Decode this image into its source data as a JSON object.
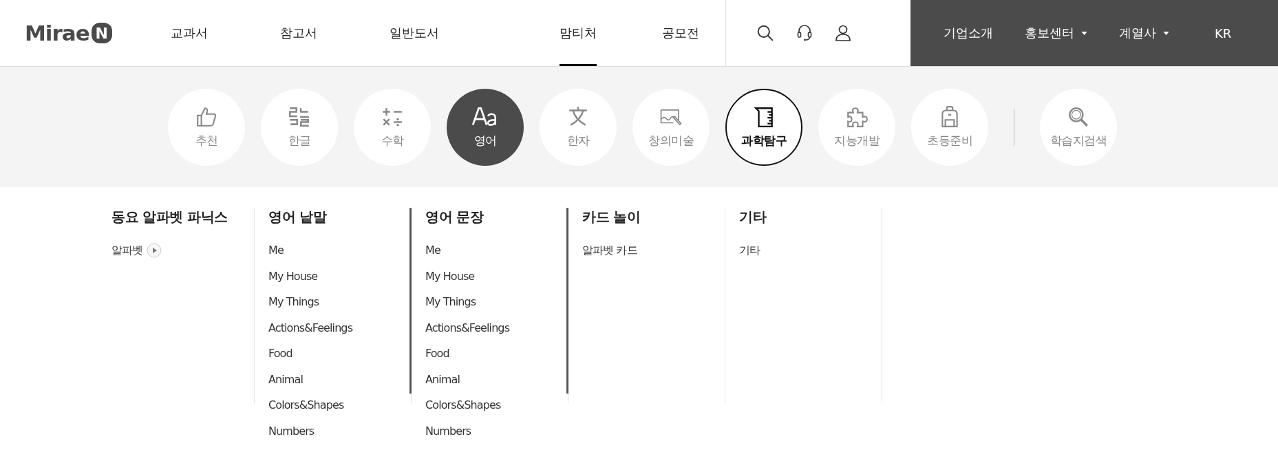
{
  "header": {
    "logo": {
      "text": "Mirae",
      "badge": "N"
    },
    "nav": [
      {
        "label": "교과서",
        "selected": false
      },
      {
        "label": "참고서",
        "selected": false
      },
      {
        "label": "일반도서",
        "selected": false
      },
      {
        "label": "맘티처",
        "selected": true
      },
      {
        "label": "공모전",
        "selected": false
      }
    ],
    "utility": [
      {
        "label": "기업소개",
        "dropdown": false
      },
      {
        "label": "홍보센터",
        "dropdown": true
      },
      {
        "label": "계열사",
        "dropdown": true
      },
      {
        "label": "KR",
        "dropdown": false
      }
    ]
  },
  "categories": [
    {
      "label": "추천",
      "selected": false,
      "highlighted": false
    },
    {
      "label": "한글",
      "selected": false,
      "highlighted": false
    },
    {
      "label": "수학",
      "selected": false,
      "highlighted": false
    },
    {
      "label": "영어",
      "selected": true,
      "highlighted": false
    },
    {
      "label": "한자",
      "selected": false,
      "highlighted": false
    },
    {
      "label": "창의미술",
      "selected": false,
      "highlighted": false
    },
    {
      "label": "과학탐구",
      "selected": false,
      "highlighted": true
    },
    {
      "label": "지능개발",
      "selected": false,
      "highlighted": false
    },
    {
      "label": "초등준비",
      "selected": false,
      "highlighted": false
    }
  ],
  "search_category": {
    "label": "학습지검색"
  },
  "menu_columns": [
    {
      "heading": "동요 알파벳 파닉스",
      "scrollbar": false,
      "items": [
        {
          "label": "알파벳",
          "kind": "play"
        }
      ]
    },
    {
      "heading": "영어 낱말",
      "scrollbar": true,
      "items": [
        {
          "label": "Me",
          "kind": "plain"
        },
        {
          "label": "My House",
          "kind": "plain"
        },
        {
          "label": "My Things",
          "kind": "plain"
        },
        {
          "label": "Actions&Feelings",
          "kind": "plain"
        },
        {
          "label": "Food",
          "kind": "plain"
        },
        {
          "label": "Animal",
          "kind": "plain"
        },
        {
          "label": "Colors&Shapes",
          "kind": "plain"
        },
        {
          "label": "Numbers",
          "kind": "plain"
        }
      ]
    },
    {
      "heading": "영어 문장",
      "scrollbar": true,
      "items": [
        {
          "label": "Me",
          "kind": "plain"
        },
        {
          "label": "My House",
          "kind": "plain"
        },
        {
          "label": "My Things",
          "kind": "plain"
        },
        {
          "label": "Actions&Feelings",
          "kind": "plain"
        },
        {
          "label": "Food",
          "kind": "plain"
        },
        {
          "label": "Animal",
          "kind": "plain"
        },
        {
          "label": "Colors&Shapes",
          "kind": "plain"
        },
        {
          "label": "Numbers",
          "kind": "plain"
        }
      ]
    },
    {
      "heading": "카드 놀이",
      "scrollbar": false,
      "items": [
        {
          "label": "알파벳 카드",
          "kind": "plain"
        }
      ]
    },
    {
      "heading": "기타",
      "scrollbar": false,
      "items": [
        {
          "label": "기타",
          "kind": "plain"
        }
      ]
    }
  ]
}
